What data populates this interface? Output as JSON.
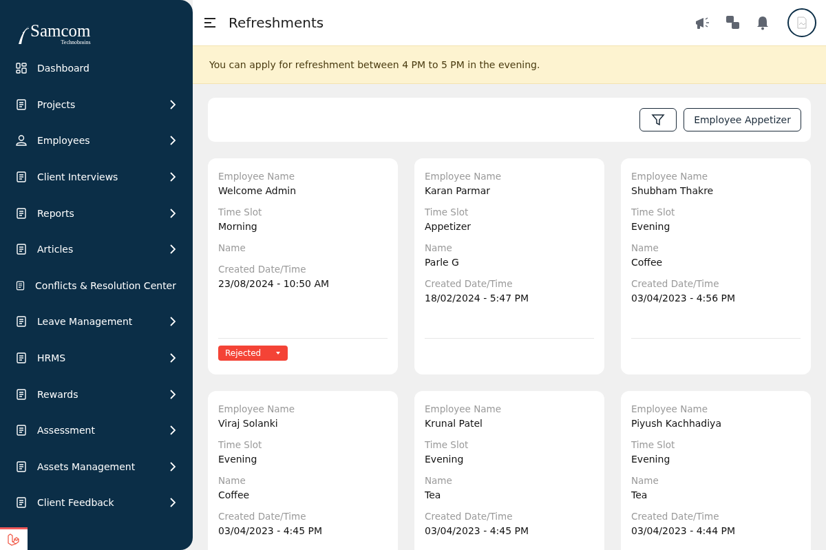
{
  "logo": {
    "name": "Samcom",
    "tagline": "Technobrains"
  },
  "sidebar": {
    "items": [
      {
        "label": "Dashboard",
        "expandable": false
      },
      {
        "label": "Projects",
        "expandable": true
      },
      {
        "label": "Employees",
        "expandable": true
      },
      {
        "label": "Client Interviews",
        "expandable": true
      },
      {
        "label": "Reports",
        "expandable": true
      },
      {
        "label": "Articles",
        "expandable": true
      },
      {
        "label": "Conflicts & Resolution Center",
        "expandable": false
      },
      {
        "label": "Leave Management",
        "expandable": true
      },
      {
        "label": "HRMS",
        "expandable": true
      },
      {
        "label": "Rewards",
        "expandable": true
      },
      {
        "label": "Assessment",
        "expandable": true
      },
      {
        "label": "Assets Management",
        "expandable": true
      },
      {
        "label": "Client Feedback",
        "expandable": true
      }
    ]
  },
  "header": {
    "title": "Refreshments"
  },
  "notice": "You can apply for refreshment between 4 PM to 5 PM in the evening.",
  "toolbar": {
    "button": "Employee Appetizer"
  },
  "cards": [
    {
      "fields": [
        {
          "label": "Employee Name",
          "value": "Welcome Admin"
        },
        {
          "label": "Time Slot",
          "value": "Morning"
        },
        {
          "label": "Name"
        },
        {
          "label": "Created Date/Time",
          "value": "23/08/2024 - 10:50 AM"
        }
      ],
      "status": {
        "label": "Rejected",
        "color": "#f44336"
      }
    },
    {
      "fields": [
        {
          "label": "Employee Name",
          "value": "Karan Parmar"
        },
        {
          "label": "Time Slot",
          "value": "Appetizer"
        },
        {
          "label": "Name",
          "value": "Parle G"
        },
        {
          "label": "Created Date/Time",
          "value": "18/02/2024 - 5:47 PM"
        }
      ]
    },
    {
      "fields": [
        {
          "label": "Employee Name",
          "value": "Shubham Thakre"
        },
        {
          "label": "Time Slot",
          "value": "Evening"
        },
        {
          "label": "Name",
          "value": "Coffee"
        },
        {
          "label": "Created Date/Time",
          "value": "03/04/2023 - 4:56 PM"
        }
      ]
    },
    {
      "fields": [
        {
          "label": "Employee Name",
          "value": "Viraj Solanki"
        },
        {
          "label": "Time Slot",
          "value": "Evening"
        },
        {
          "label": "Name",
          "value": "Coffee"
        },
        {
          "label": "Created Date/Time",
          "value": "03/04/2023 - 4:45 PM"
        }
      ]
    },
    {
      "fields": [
        {
          "label": "Employee Name",
          "value": "Krunal Patel"
        },
        {
          "label": "Time Slot",
          "value": "Evening"
        },
        {
          "label": "Name",
          "value": "Tea"
        },
        {
          "label": "Created Date/Time",
          "value": "03/04/2023 - 4:45 PM"
        }
      ]
    },
    {
      "fields": [
        {
          "label": "Employee Name",
          "value": "Piyush Kachhadiya"
        },
        {
          "label": "Time Slot",
          "value": "Evening"
        },
        {
          "label": "Name",
          "value": "Tea"
        },
        {
          "label": "Created Date/Time",
          "value": "03/04/2023 - 4:44 PM"
        }
      ]
    }
  ]
}
